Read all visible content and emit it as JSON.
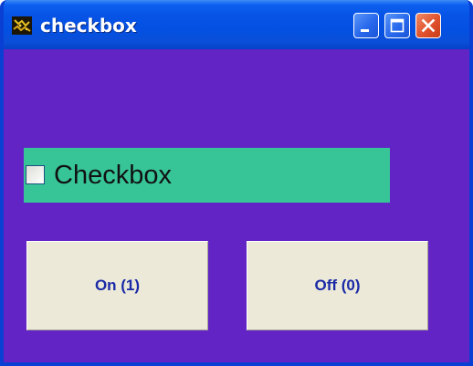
{
  "window": {
    "title": "checkbox",
    "app_icon": "app-icon",
    "controls": {
      "minimize_icon": "minimize-icon",
      "maximize_icon": "maximize-icon",
      "close_icon": "close-icon"
    }
  },
  "checkbox": {
    "label": "Checkbox",
    "checked": false,
    "background_color": "#37c597"
  },
  "buttons": {
    "on_label": "On (1)",
    "off_label": "Off (0)",
    "label_color": "#1b2aa6"
  },
  "colors": {
    "client_background": "#6224c5",
    "titlebar": "#0450e2",
    "button_face": "#ece9d8"
  }
}
